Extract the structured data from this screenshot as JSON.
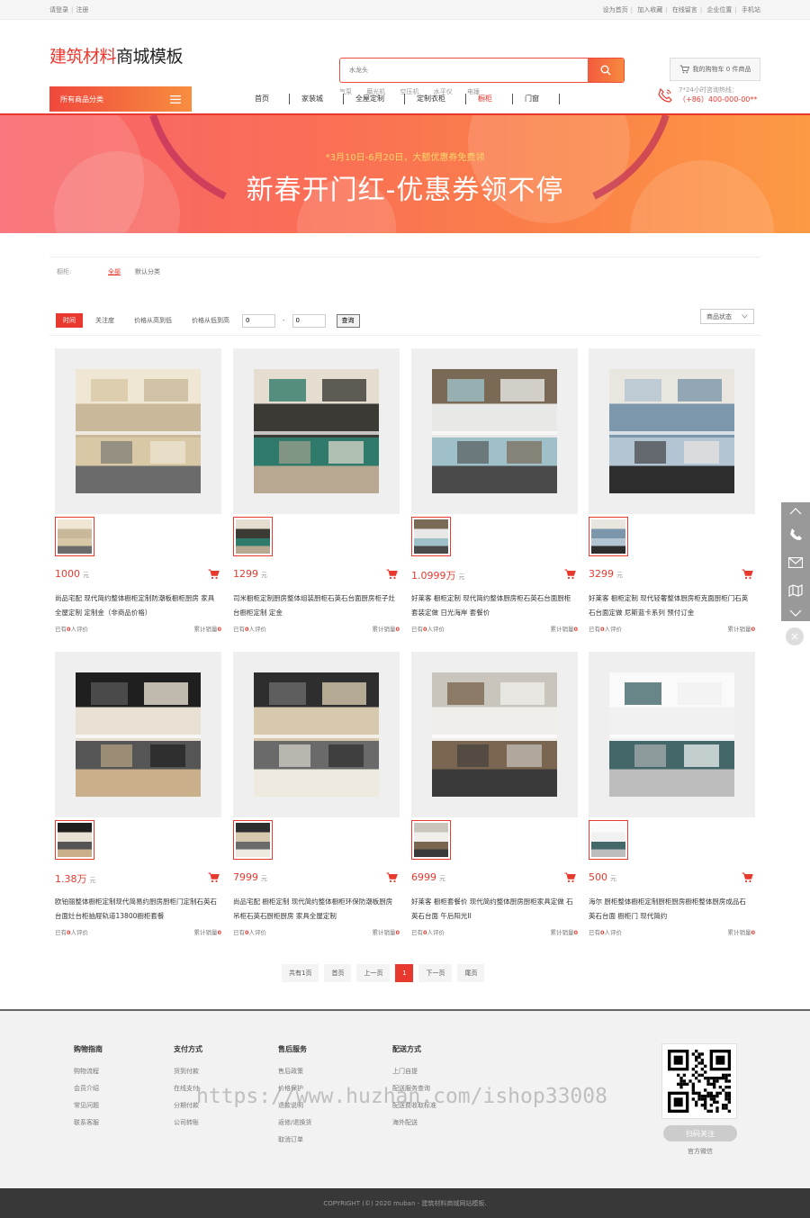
{
  "topbar": {
    "login": "请登录",
    "register": "注册",
    "links": [
      "设为首页",
      "加入收藏",
      "在线留言",
      "企业位置",
      "手机站"
    ]
  },
  "header": {
    "logo_red": "建筑材料",
    "logo_black": "商城模板",
    "search_placeholder": "水龙头",
    "hotwords": [
      "气泵",
      "磨光机",
      "空压机",
      "水平仪",
      "电锤"
    ],
    "cart_text": "我的购物车 0 件商品"
  },
  "nav": {
    "all_categories": "所有商品分类",
    "items": [
      "首页",
      "家装城",
      "全屋定制",
      "定制衣柜",
      "橱柜",
      "门窗"
    ],
    "active_item": "橱柜",
    "hotline_label": "7*24小时咨询热线：",
    "hotline_number": "（+86）400-000-00**"
  },
  "banner": {
    "subtitle": "*3月10日-6月20日，大额优惠券免费领",
    "title": "新春开门红-优惠券领不停"
  },
  "filter": {
    "label": "橱柜:",
    "options": [
      "全部",
      "默认分类"
    ]
  },
  "sortbar": {
    "sorts": [
      "时间",
      "关注度",
      "价格从高到低",
      "价格从低到高"
    ],
    "min_value": "0",
    "max_value": "0",
    "dash": "-",
    "query_label": "查询",
    "status_label": "商品状态"
  },
  "products": [
    {
      "price": "1000",
      "unit": "元",
      "title": "尚品宅配 现代简约整体橱柜定制防潮板橱柜厨房 家具全屋定制 定制金（非商品价格）",
      "review_pre": "已有",
      "reviews": "0",
      "review_post": "人评价",
      "sales_pre": "累计销量",
      "sales": "0"
    },
    {
      "price": "1299",
      "unit": "元",
      "title": "司米橱柜定制厨房整体组装厨柜石英石台面厨房柜子灶台橱柜定制 定金",
      "review_pre": "已有",
      "reviews": "0",
      "review_post": "人评价",
      "sales_pre": "累计销量",
      "sales": "0"
    },
    {
      "price": "1.0999万",
      "unit": "元",
      "title": "好莱客 橱柜定制 现代简约整体厨房柜石英石台面厨柜套装定做 日光海岸 套餐价",
      "review_pre": "已有",
      "reviews": "0",
      "review_post": "人评价",
      "sales_pre": "累计销量",
      "sales": "0"
    },
    {
      "price": "3299",
      "unit": "元",
      "title": "好莱客 橱柜定制 现代轻奢整体厨房柜克面厨柜门石英石台面定做 尼斯蓝卡系列 预付订金",
      "review_pre": "已有",
      "reviews": "0",
      "review_post": "人评价",
      "sales_pre": "累计销量",
      "sales": "0"
    },
    {
      "price": "1.38万",
      "unit": "元",
      "title": "欧铂丽整体橱柜定制现代简易约厨房厨柜门定制石英石台面灶台柜抽屉轨道13800橱柜套餐",
      "review_pre": "已有",
      "reviews": "0",
      "review_post": "人评价",
      "sales_pre": "累计销量",
      "sales": "0"
    },
    {
      "price": "7999",
      "unit": "元",
      "title": "尚品宅配 橱柜定制 现代简约整体橱柜环保防潮板厨房吊柜石英石厨柜厨房 家具全屋定制",
      "review_pre": "已有",
      "reviews": "0",
      "review_post": "人评价",
      "sales_pre": "累计销量",
      "sales": "0"
    },
    {
      "price": "6999",
      "unit": "元",
      "title": "好莱客 橱柜套餐价 现代简约整体厨房厨柜家具定做 石英石台面 午后阳光II",
      "review_pre": "已有",
      "reviews": "0",
      "review_post": "人评价",
      "sales_pre": "累计销量",
      "sales": "0"
    },
    {
      "price": "500",
      "unit": "元",
      "title": "海尔 厨柜整体橱柜定制厨柜厨房橱柜整体厨房成品石英石台面 橱柜门 现代简约",
      "review_pre": "已有",
      "reviews": "0",
      "review_post": "人评价",
      "sales_pre": "累计销量",
      "sales": "0"
    }
  ],
  "pager": {
    "total": "共有1页",
    "first": "首页",
    "prev": "上一页",
    "current": "1",
    "next": "下一页",
    "last": "尾页"
  },
  "footer": {
    "columns": [
      {
        "title": "购物指南",
        "items": [
          "购物流程",
          "会员介绍",
          "常见问题",
          "联系客服"
        ]
      },
      {
        "title": "支付方式",
        "items": [
          "货到付款",
          "在线支付",
          "分期付款",
          "公司转账"
        ]
      },
      {
        "title": "售后服务",
        "items": [
          "售后政策",
          "价格保护",
          "退款说明",
          "返修/退换货",
          "取消订单"
        ]
      },
      {
        "title": "配送方式",
        "items": [
          "上门自提",
          "配送服务查询",
          "配送费收取标准",
          "海外配送"
        ]
      }
    ],
    "follow_label": "扫码关注",
    "official_label": "官方微信",
    "watermark": "https://www.huzhan.com/ishop33008",
    "copyright": "COPYRIGHT (©) 2020 muban - 建筑材料商城网站模板."
  },
  "colors": {
    "accent": "#e8392f",
    "gradient_end": "#f78e3f"
  }
}
